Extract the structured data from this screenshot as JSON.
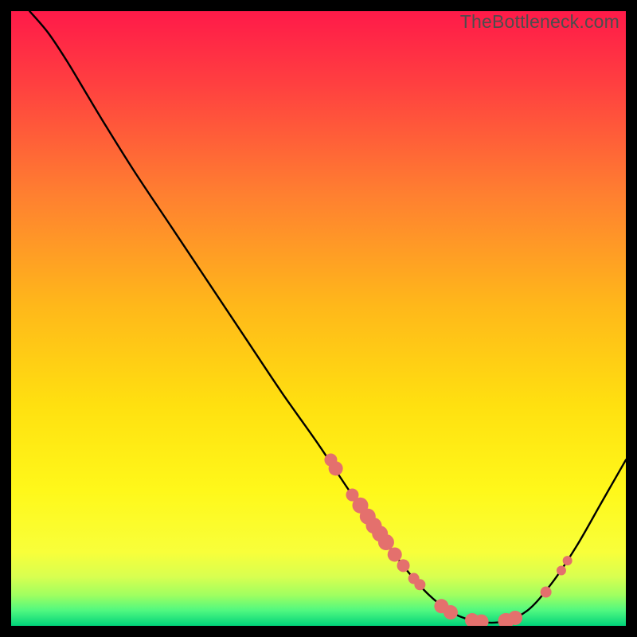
{
  "watermark": "TheBottleneck.com",
  "chart_data": {
    "type": "line",
    "title": "",
    "xlabel": "",
    "ylabel": "",
    "xlim": [
      0,
      100
    ],
    "ylim": [
      0,
      100
    ],
    "background_gradient": {
      "stops": [
        {
          "offset": 0.0,
          "color": "#ff1a49"
        },
        {
          "offset": 0.12,
          "color": "#ff4040"
        },
        {
          "offset": 0.3,
          "color": "#ff8030"
        },
        {
          "offset": 0.48,
          "color": "#ffb81a"
        },
        {
          "offset": 0.64,
          "color": "#ffe010"
        },
        {
          "offset": 0.78,
          "color": "#fff81a"
        },
        {
          "offset": 0.88,
          "color": "#f8ff3a"
        },
        {
          "offset": 0.92,
          "color": "#d8ff50"
        },
        {
          "offset": 0.95,
          "color": "#a0ff60"
        },
        {
          "offset": 0.975,
          "color": "#50f880"
        },
        {
          "offset": 1.0,
          "color": "#00d37a"
        }
      ]
    },
    "curve": {
      "comment": "Bottleneck-style curve. x in [0,100], y in [0,100] where y=0 is optimal (bottom/green) and y=100 is worst (top/red). Plunges from top-left, reaches a flat minimum around x≈74-82, then rises toward the right edge.",
      "points": [
        {
          "x": 3.0,
          "y": 100.0
        },
        {
          "x": 6.0,
          "y": 96.5
        },
        {
          "x": 9.0,
          "y": 92.0
        },
        {
          "x": 12.0,
          "y": 87.0
        },
        {
          "x": 15.0,
          "y": 82.0
        },
        {
          "x": 20.0,
          "y": 74.0
        },
        {
          "x": 26.0,
          "y": 65.0
        },
        {
          "x": 32.0,
          "y": 56.0
        },
        {
          "x": 38.0,
          "y": 47.0
        },
        {
          "x": 44.0,
          "y": 38.0
        },
        {
          "x": 50.0,
          "y": 29.5
        },
        {
          "x": 55.0,
          "y": 22.0
        },
        {
          "x": 60.0,
          "y": 15.0
        },
        {
          "x": 64.0,
          "y": 9.5
        },
        {
          "x": 68.0,
          "y": 5.0
        },
        {
          "x": 72.0,
          "y": 2.0
        },
        {
          "x": 76.0,
          "y": 0.7
        },
        {
          "x": 80.0,
          "y": 0.7
        },
        {
          "x": 84.0,
          "y": 2.5
        },
        {
          "x": 88.0,
          "y": 7.0
        },
        {
          "x": 92.0,
          "y": 13.0
        },
        {
          "x": 96.0,
          "y": 20.0
        },
        {
          "x": 100.0,
          "y": 27.0
        }
      ]
    },
    "markers": {
      "color": "#e4706d",
      "default_radius": 8,
      "points": [
        {
          "x": 52.0,
          "y": 27.0,
          "r": 8
        },
        {
          "x": 52.8,
          "y": 25.6,
          "r": 9
        },
        {
          "x": 55.5,
          "y": 21.3,
          "r": 8
        },
        {
          "x": 56.8,
          "y": 19.6,
          "r": 10
        },
        {
          "x": 58.0,
          "y": 17.8,
          "r": 10
        },
        {
          "x": 59.0,
          "y": 16.3,
          "r": 10
        },
        {
          "x": 60.0,
          "y": 15.0,
          "r": 10
        },
        {
          "x": 61.0,
          "y": 13.6,
          "r": 10
        },
        {
          "x": 62.4,
          "y": 11.6,
          "r": 9
        },
        {
          "x": 63.8,
          "y": 9.8,
          "r": 8
        },
        {
          "x": 65.5,
          "y": 7.7,
          "r": 7
        },
        {
          "x": 66.5,
          "y": 6.7,
          "r": 7
        },
        {
          "x": 70.0,
          "y": 3.2,
          "r": 9
        },
        {
          "x": 71.5,
          "y": 2.2,
          "r": 9
        },
        {
          "x": 75.0,
          "y": 0.9,
          "r": 9
        },
        {
          "x": 76.5,
          "y": 0.7,
          "r": 9
        },
        {
          "x": 80.5,
          "y": 0.8,
          "r": 10
        },
        {
          "x": 82.0,
          "y": 1.3,
          "r": 9
        },
        {
          "x": 87.0,
          "y": 5.5,
          "r": 7
        },
        {
          "x": 89.5,
          "y": 9.0,
          "r": 6
        },
        {
          "x": 90.5,
          "y": 10.6,
          "r": 6
        }
      ]
    }
  }
}
